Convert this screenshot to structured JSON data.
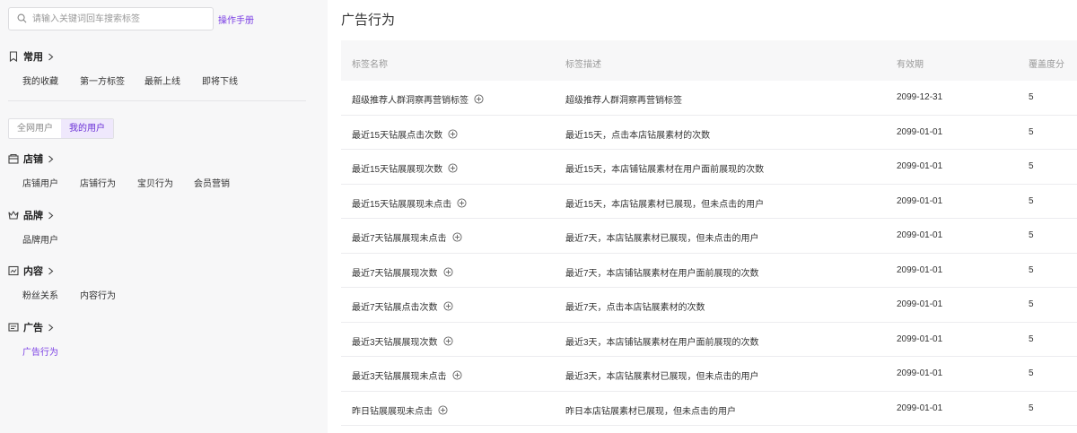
{
  "search": {
    "placeholder": "请输入关键词回车搜索标签"
  },
  "manual_link": "操作手册",
  "sections_top": {
    "common": {
      "title": "常用",
      "items": [
        "我的收藏",
        "第一方标签",
        "最新上线",
        "即将下线"
      ]
    }
  },
  "user_toggle": {
    "options": [
      "全网用户",
      "我的用户"
    ],
    "selected": "我的用户"
  },
  "sections": [
    {
      "title": "店铺",
      "icon": "store-icon",
      "items": [
        "店铺用户",
        "店铺行为",
        "宝贝行为",
        "会员营销"
      ]
    },
    {
      "title": "品牌",
      "icon": "crown-icon",
      "items": [
        "品牌用户"
      ]
    },
    {
      "title": "内容",
      "icon": "content-icon",
      "items": [
        "粉丝关系",
        "内容行为"
      ]
    },
    {
      "title": "广告",
      "icon": "ad-icon",
      "items": [
        "广告行为"
      ]
    }
  ],
  "active_item": "广告行为",
  "accent_color": "#7b3fe4",
  "main": {
    "title": "广告行为",
    "columns": [
      "标签名称",
      "标签描述",
      "有效期",
      "覆盖度分"
    ],
    "rows": [
      {
        "name": "超级推荐人群洞察再营销标签",
        "desc": "超级推荐人群洞察再营销标签",
        "valid": "2099-12-31",
        "coverage": "5"
      },
      {
        "name": "最近15天钻展点击次数",
        "desc": "最近15天，点击本店钻展素材的次数",
        "valid": "2099-01-01",
        "coverage": "5"
      },
      {
        "name": "最近15天钻展展现次数",
        "desc": "最近15天，本店铺钻展素材在用户面前展现的次数",
        "valid": "2099-01-01",
        "coverage": "5"
      },
      {
        "name": "最近15天钻展展现未点击",
        "desc": "最近15天，本店钻展素材已展现，但未点击的用户",
        "valid": "2099-01-01",
        "coverage": "5"
      },
      {
        "name": "最近7天钻展展现未点击",
        "desc": "最近7天，本店钻展素材已展现，但未点击的用户",
        "valid": "2099-01-01",
        "coverage": "5"
      },
      {
        "name": "最近7天钻展展现次数",
        "desc": "最近7天，本店铺钻展素材在用户面前展现的次数",
        "valid": "2099-01-01",
        "coverage": "5"
      },
      {
        "name": "最近7天钻展点击次数",
        "desc": "最近7天，点击本店钻展素材的次数",
        "valid": "2099-01-01",
        "coverage": "5"
      },
      {
        "name": "最近3天钻展展现次数",
        "desc": "最近3天，本店铺钻展素材在用户面前展现的次数",
        "valid": "2099-01-01",
        "coverage": "5"
      },
      {
        "name": "最近3天钻展展现未点击",
        "desc": "最近3天，本店钻展素材已展现，但未点击的用户",
        "valid": "2099-01-01",
        "coverage": "5"
      },
      {
        "name": "昨日钻展展现未点击",
        "desc": "昨日本店钻展素材已展现，但未点击的用户",
        "valid": "2099-01-01",
        "coverage": "5"
      }
    ]
  }
}
